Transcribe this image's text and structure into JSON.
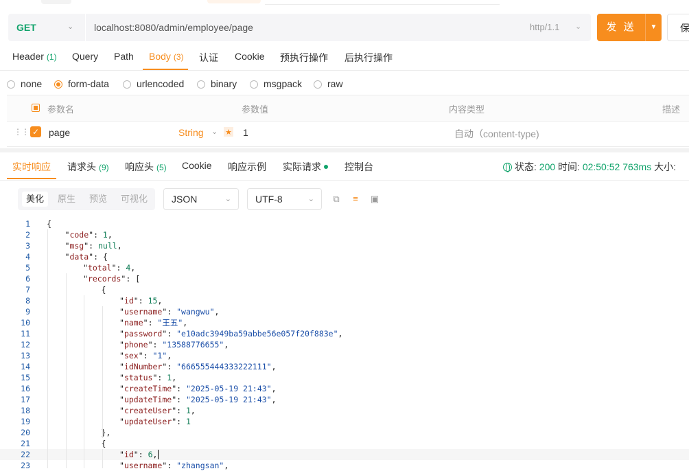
{
  "url_bar": {
    "method": "GET",
    "url": "localhost:8080/admin/employee/page",
    "protocol": "http/1.1",
    "send_label": "发 送",
    "save_label": "保"
  },
  "request_tabs": [
    {
      "label": "Header",
      "count": "(1)"
    },
    {
      "label": "Query",
      "count": ""
    },
    {
      "label": "Path",
      "count": ""
    },
    {
      "label": "Body",
      "count": "(3)",
      "active": true
    },
    {
      "label": "认证",
      "count": ""
    },
    {
      "label": "Cookie",
      "count": ""
    },
    {
      "label": "预执行操作",
      "count": ""
    },
    {
      "label": "后执行操作",
      "count": ""
    }
  ],
  "body_types": [
    "none",
    "form-data",
    "urlencoded",
    "binary",
    "msgpack",
    "raw"
  ],
  "body_type_selected": "form-data",
  "params_table": {
    "headers": [
      "参数名",
      "参数值",
      "内容类型",
      "描述"
    ],
    "rows": [
      {
        "name": "page",
        "type": "String",
        "value": "1",
        "content_type": "自动（content-type)"
      }
    ]
  },
  "response_tabs": [
    {
      "label": "实时响应",
      "count": "",
      "active": true
    },
    {
      "label": "请求头",
      "count": "(9)"
    },
    {
      "label": "响应头",
      "count": "(5)"
    },
    {
      "label": "Cookie",
      "count": ""
    },
    {
      "label": "响应示例",
      "count": ""
    },
    {
      "label": "实际请求",
      "count": "",
      "dot": true
    },
    {
      "label": "控制台",
      "count": ""
    }
  ],
  "response_status": {
    "status_label": "状态:",
    "status_value": "200",
    "time_label": "时间:",
    "time_value": "02:50:52",
    "duration": "763ms",
    "size_label": "大小:"
  },
  "view_modes": [
    "美化",
    "原生",
    "预览",
    "可视化"
  ],
  "view_mode_active": "美化",
  "format_select": "JSON",
  "encoding_select": "UTF-8",
  "toolbar_icons": [
    "copy-icon",
    "wrap-icon",
    "save-icon"
  ],
  "colors": {
    "accent": "#f78d1e",
    "success": "#11a36b",
    "line_number": "#1f5aa6"
  },
  "code_lines": [
    {
      "n": "1",
      "indent": 0,
      "text": "{"
    },
    {
      "n": "2",
      "indent": 1,
      "key": "code",
      "value": "1",
      "vt": "n",
      "comma": ","
    },
    {
      "n": "3",
      "indent": 1,
      "key": "msg",
      "value": "null",
      "vt": "n",
      "comma": ","
    },
    {
      "n": "4",
      "indent": 1,
      "key": "data",
      "value": "{",
      "vt": "p",
      "comma": ""
    },
    {
      "n": "5",
      "indent": 2,
      "key": "total",
      "value": "4",
      "vt": "n",
      "comma": ","
    },
    {
      "n": "6",
      "indent": 2,
      "key": "records",
      "value": "[",
      "vt": "p",
      "comma": ""
    },
    {
      "n": "7",
      "indent": 3,
      "text": "{"
    },
    {
      "n": "8",
      "indent": 4,
      "key": "id",
      "value": "15",
      "vt": "n",
      "comma": ","
    },
    {
      "n": "9",
      "indent": 4,
      "key": "username",
      "value": "\"wangwu\"",
      "vt": "s",
      "comma": ","
    },
    {
      "n": "10",
      "indent": 4,
      "key": "name",
      "value": "\"王五\"",
      "vt": "s",
      "comma": ","
    },
    {
      "n": "11",
      "indent": 4,
      "key": "password",
      "value": "\"e10adc3949ba59abbe56e057f20f883e\"",
      "vt": "s",
      "comma": ","
    },
    {
      "n": "12",
      "indent": 4,
      "key": "phone",
      "value": "\"13588776655\"",
      "vt": "s",
      "comma": ","
    },
    {
      "n": "13",
      "indent": 4,
      "key": "sex",
      "value": "\"1\"",
      "vt": "s",
      "comma": ","
    },
    {
      "n": "14",
      "indent": 4,
      "key": "idNumber",
      "value": "\"666555444333222111\"",
      "vt": "s",
      "comma": ","
    },
    {
      "n": "15",
      "indent": 4,
      "key": "status",
      "value": "1",
      "vt": "n",
      "comma": ","
    },
    {
      "n": "16",
      "indent": 4,
      "key": "createTime",
      "value": "\"2025-05-19 21:43\"",
      "vt": "s",
      "comma": ","
    },
    {
      "n": "17",
      "indent": 4,
      "key": "updateTime",
      "value": "\"2025-05-19 21:43\"",
      "vt": "s",
      "comma": ","
    },
    {
      "n": "18",
      "indent": 4,
      "key": "createUser",
      "value": "1",
      "vt": "n",
      "comma": ","
    },
    {
      "n": "19",
      "indent": 4,
      "key": "updateUser",
      "value": "1",
      "vt": "n",
      "comma": ""
    },
    {
      "n": "20",
      "indent": 3,
      "text": "},"
    },
    {
      "n": "21",
      "indent": 3,
      "text": "{"
    },
    {
      "n": "22",
      "indent": 4,
      "key": "id",
      "value": "6",
      "vt": "n",
      "comma": ",",
      "current": true
    },
    {
      "n": "23",
      "indent": 4,
      "key": "username",
      "value": "\"zhangsan\"",
      "vt": "s",
      "comma": ","
    }
  ]
}
